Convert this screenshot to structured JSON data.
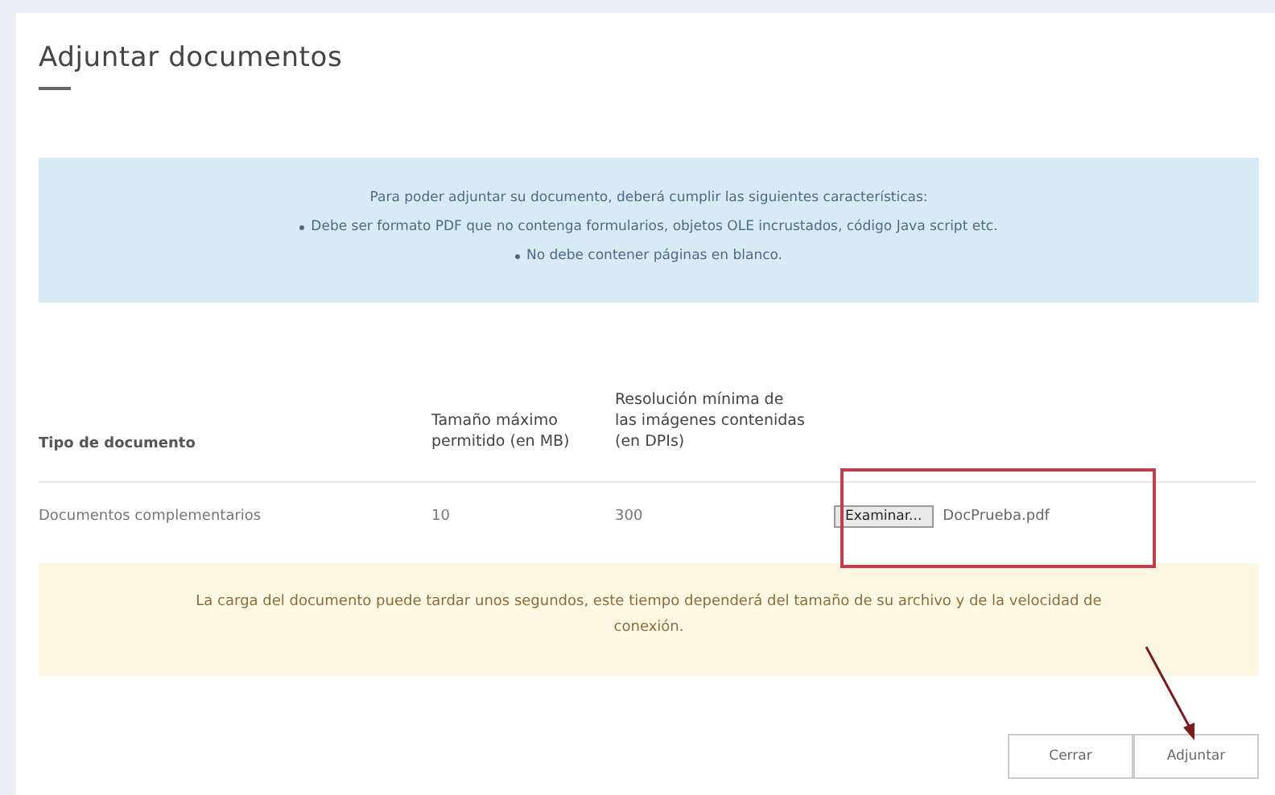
{
  "dialog": {
    "title": "Adjuntar documentos"
  },
  "requirements": {
    "intro": "Para poder adjuntar su documento, deberá cumplir las siguientes características:",
    "items": [
      "Debe ser formato PDF que no contenga formularios, objetos OLE incrustados, código Java script etc.",
      "No debe contener páginas en blanco."
    ]
  },
  "table": {
    "columns": [
      "Tipo de documento",
      "Tamaño máximo permitido (en MB)",
      "Resolución mínima de las imágenes contenidas (en DPIs)"
    ],
    "rows": [
      {
        "type": "Documentos complementarios",
        "max_size": "10",
        "min_resolution": "300",
        "browse_button": "Examinar...",
        "file_name": "DocPrueba.pdf"
      }
    ]
  },
  "notice": "La carga del documento puede tardar unos segundos, este tiempo dependerá del tamaño de su archivo y de la velocidad de conexión.",
  "buttons": [
    "Cerrar",
    "Adjuntar"
  ]
}
